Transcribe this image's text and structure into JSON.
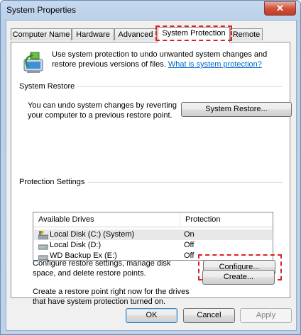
{
  "window": {
    "title": "System Properties",
    "close_label": "✕"
  },
  "tabs": [
    "Computer Name",
    "Hardware",
    "Advanced",
    "System Protection",
    "Remote"
  ],
  "intro": {
    "text": "Use system protection to undo unwanted system changes and restore previous versions of files.",
    "link": "What is system protection?"
  },
  "system_restore": {
    "heading": "System Restore",
    "text": "You can undo system changes by reverting your computer to a previous restore point.",
    "button": "System Restore..."
  },
  "protection": {
    "heading": "Protection Settings",
    "columns": [
      "Available Drives",
      "Protection"
    ],
    "drives": [
      {
        "name": "Local Disk (C:) (System)",
        "protection": "On",
        "icon": "system-drive-icon"
      },
      {
        "name": "Local Disk (D:)",
        "protection": "Off",
        "icon": "hard-drive-icon"
      },
      {
        "name": "WD Backup Ex  (E:)",
        "protection": "Off",
        "icon": "hard-drive-icon"
      }
    ],
    "configure_text": "Configure restore settings, manage disk space, and delete restore points.",
    "configure_button": "Configure...",
    "create_text": "Create a restore point right now for the drives that have system protection turned on.",
    "create_button": "Create..."
  },
  "footer": {
    "ok": "OK",
    "cancel": "Cancel",
    "apply": "Apply"
  },
  "colors": {
    "highlight": "#e02020",
    "link": "#0066cc"
  }
}
